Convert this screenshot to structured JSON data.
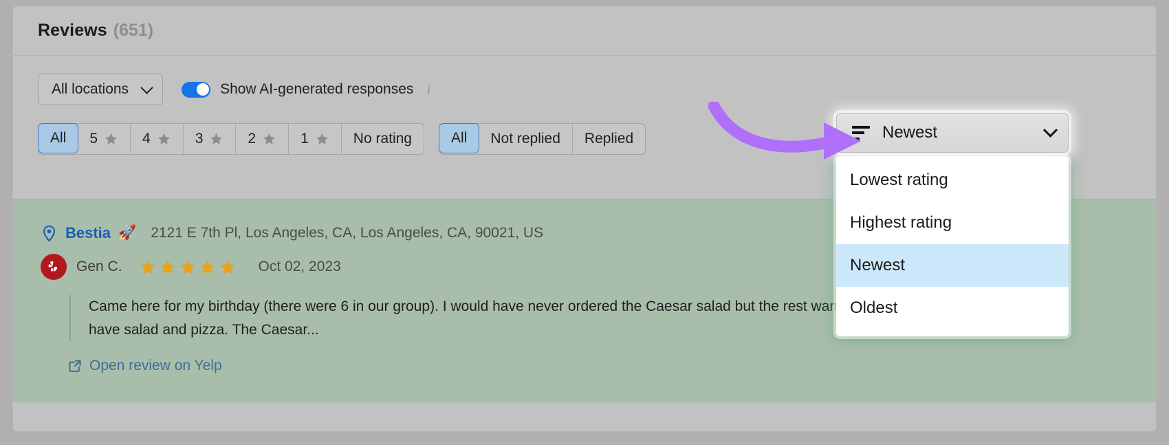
{
  "panel": {
    "title": "Reviews",
    "count": "(651)"
  },
  "toolbar": {
    "location_select": {
      "value": "All locations",
      "chevron_icon": "chevron-down-icon"
    },
    "ai_toggle": {
      "label": "Show AI-generated responses",
      "state": "on",
      "info_icon": "info-icon"
    },
    "rating_filters": [
      {
        "label": "All",
        "star": false,
        "active": true
      },
      {
        "label": "5",
        "star": true,
        "active": false
      },
      {
        "label": "4",
        "star": true,
        "active": false
      },
      {
        "label": "3",
        "star": true,
        "active": false
      },
      {
        "label": "2",
        "star": true,
        "active": false
      },
      {
        "label": "1",
        "star": true,
        "active": false
      },
      {
        "label": "No rating",
        "star": false,
        "active": false
      }
    ],
    "reply_filters": [
      {
        "label": "All",
        "active": true
      },
      {
        "label": "Not replied",
        "active": false
      },
      {
        "label": "Replied",
        "active": false
      }
    ]
  },
  "sort": {
    "icon": "sort-descending-icon",
    "value": "Newest",
    "chevron_icon": "chevron-down-icon",
    "options": [
      {
        "label": "Lowest rating",
        "selected": false
      },
      {
        "label": "Highest rating",
        "selected": false
      },
      {
        "label": "Newest",
        "selected": true
      },
      {
        "label": "Oldest",
        "selected": false
      }
    ]
  },
  "review": {
    "pin_icon": "location-pin-icon",
    "business_name": "Bestia",
    "business_emoji": "🚀",
    "address": "2121 E 7th Pl, Los Angeles, CA, Los Angeles, CA, 90021, US",
    "source_icon": "yelp-logo-icon",
    "reviewer": "Gen C.",
    "rating": 5,
    "date": "Oct 02, 2023",
    "text": "Came here for my birthday (there were 6 in our group).  I would have never ordered the Caesar salad but the rest wanted to have salad and pizza.  The Caesar...",
    "link": {
      "label": "Open review on Yelp",
      "icon": "external-link-icon"
    }
  },
  "annotation": {
    "arrow_color": "#b06ffb",
    "arrow_icon": "curved-arrow-right-icon"
  },
  "colors": {
    "accent_blue": "#1574e8",
    "selected_row": "#cde8fa",
    "star_gold": "#e8a317",
    "card_bg": "#a9bdab"
  }
}
